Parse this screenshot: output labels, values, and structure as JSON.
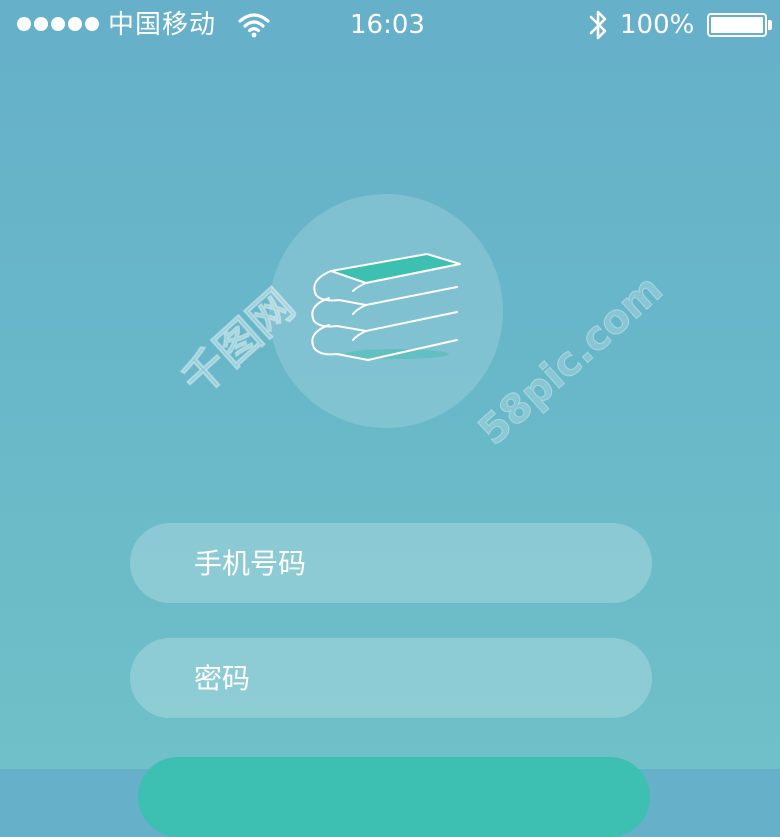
{
  "status_bar": {
    "carrier": "中国移动",
    "time": "16:03",
    "battery_percent": "100%",
    "battery_level": 1.0,
    "signal_icon": "signal-dots-icon",
    "wifi_icon": "wifi-icon",
    "bluetooth_icon": "bluetooth-icon",
    "battery_icon": "battery-icon"
  },
  "logo": {
    "icon": "books-stack-icon"
  },
  "watermarks": {
    "left": "千图网",
    "right": "58pic.com"
  },
  "form": {
    "phone_placeholder": "手机号码",
    "password_placeholder": "密码"
  },
  "colors": {
    "background_top": "#66b0c9",
    "background_bottom": "#6fc0c8",
    "accent": "#3dbfb1",
    "text": "#ffffff"
  }
}
